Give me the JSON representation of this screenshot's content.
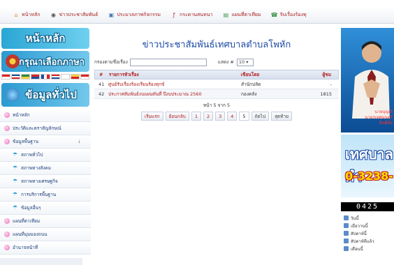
{
  "topnav": {
    "items": [
      {
        "label": "หน้าหลัก",
        "icon": "home-icon"
      },
      {
        "label": "ข่าวประชาสัมพันธ์",
        "icon": "megaphone-icon"
      },
      {
        "label": "ประมวลภาพกิจกรรม",
        "icon": "camera-icon"
      },
      {
        "label": "กระดานสนทนา",
        "icon": "forum-icon"
      },
      {
        "label": "แผนที่ตาเทียม",
        "icon": "map-icon"
      },
      {
        "label": "รับเรื่องร้องทุ",
        "icon": "phone-icon"
      }
    ]
  },
  "sidebar": {
    "banner_home": "หน้าหลัก",
    "banner_lang": "กรุณาเลือกภาษา",
    "banner_info": "ข้อมูลทั่วไป",
    "items": [
      {
        "label": "หน้าหลัก"
      },
      {
        "label": "ประวัติและตราสัญลักษณ์"
      },
      {
        "label": "ข้อมูลพื้นฐาน"
      }
    ],
    "subitems": [
      {
        "label": "สภาพทั่วไป"
      },
      {
        "label": "สภาพทางสังคม"
      },
      {
        "label": "สภาพทางเศรษฐกิจ"
      },
      {
        "label": "การบริการพื้นฐาน"
      },
      {
        "label": "ข้อมูลอื่นๆ"
      }
    ],
    "bottom_items": [
      {
        "label": "แผนที่ตาเทียม"
      },
      {
        "label": "แผนที่มุมมองถนน"
      },
      {
        "label": "อำนาจหน้าที่"
      }
    ]
  },
  "main": {
    "title": "ข่าวประชาสัมพันธ์เทศบาลตำบลโพหัก",
    "filter_label": "กรองตามชื่อเรื่อง",
    "filter_value": "",
    "rows_label": "แสดง #",
    "rows_value": "10 ▾",
    "headers": {
      "no": "#",
      "title": "รายการหัวเรื่อง",
      "publisher": "เขียนโดย",
      "views": "ผู้ชม"
    },
    "rows": [
      {
        "no": "41",
        "title": "ศูนย์รับเรื่องร้องเรียนร้องทุกข์",
        "publisher": "สำนักปลัด",
        "views": "-"
      },
      {
        "no": "42",
        "title": "ประกาศสัมพันธ์งบแผนทันที่ ปีงบประมาณ 2560",
        "publisher": "กองคลัง",
        "views": "1815"
      }
    ],
    "page_info": "หน้า 5 จาก 5",
    "pager": {
      "first": "เริ่มแรก",
      "prev": "ย้อนกลับ",
      "pages": [
        "1",
        "2",
        "3",
        "4",
        "5"
      ],
      "next": "ถัดไป",
      "last": "สุดท้าย"
    }
  },
  "right": {
    "caption_line1": "นายบุญเลิ",
    "caption_line2": "นายกเทศมนตรี",
    "caption_line3": "ยินดีต้อ",
    "contact_big1": "เทศบาลตำ",
    "contact_big2": "0-3238-",
    "counter": "0425",
    "stats": [
      "วันนี้",
      "เมื่อวานนี้",
      "สัปดาห์นี้",
      "สัปดาห์ที่แล้ว",
      "เดือนนี้"
    ]
  },
  "colors": {
    "accent": "#b11c1c",
    "title": "#1b4aa5",
    "banner": "#2aa6d4"
  }
}
